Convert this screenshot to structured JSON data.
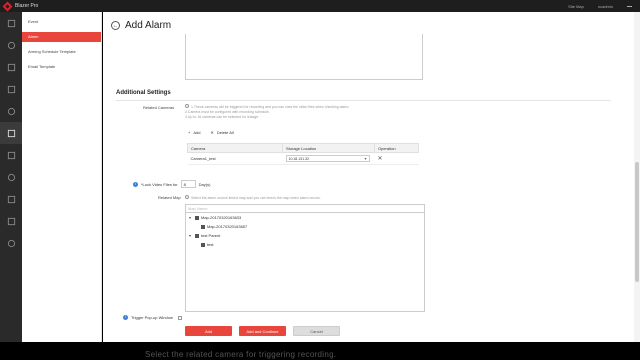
{
  "app": {
    "name": "Blazer Pro"
  },
  "topbar": {
    "site_map": "Site Map",
    "user": "ncadmin"
  },
  "rail_icons": [
    "home-icon",
    "cube-icon",
    "monitor-icon",
    "building-icon",
    "playback-icon",
    "alarm-icon",
    "grid-icon",
    "map-icon",
    "network-icon",
    "shield-icon",
    "gear-icon"
  ],
  "submenu": {
    "items": [
      {
        "label": "Event"
      },
      {
        "label": "Alarm"
      },
      {
        "label": "Arming Schedule Template"
      },
      {
        "label": "Email Template"
      }
    ],
    "active_index": 1
  },
  "page": {
    "title": "Add Alarm"
  },
  "section": {
    "title": "Additional Settings"
  },
  "related_cameras": {
    "label": "Related Cameras",
    "hint_lines": [
      "1.These cameras will be triggered for recording and you can view the video files when checking alarm.",
      "2.Camera must be configured with recording schedule.",
      "3.Up to 16 cameras can be selected for linkage."
    ],
    "add_label": "Add",
    "delete_all_label": "Delete All",
    "columns": [
      "Camera",
      "Storage Location",
      "Operation"
    ],
    "rows": [
      {
        "camera": "Camera1_test",
        "storage": "10.18.131.32"
      }
    ]
  },
  "lock_video": {
    "label": "*Lock Video Files for",
    "value": "8",
    "unit": "Day(s)"
  },
  "related_map": {
    "label": "Related Map",
    "hint": "Select the alarm source linked map and you can check the map when alarm occurs.",
    "search_placeholder": "Map Name",
    "tree": [
      {
        "label": "Map-20170320163633",
        "level": 0,
        "toggle": "▾"
      },
      {
        "label": "Map-20170320163657",
        "level": 1,
        "toggle": ""
      },
      {
        "label": "test Parent",
        "level": 0,
        "toggle": "▾"
      },
      {
        "label": "test",
        "level": 1,
        "toggle": ""
      }
    ]
  },
  "popup": {
    "label": "Trigger Pop-up Window"
  },
  "buttons": {
    "add": "Add",
    "add_continue": "Add and Continue",
    "cancel": "Cancel"
  },
  "caption": "Select the related camera for triggering recording.",
  "colors": {
    "accent": "#e8463c",
    "topbar": "#1e1e1e",
    "rail": "#2a2a2a"
  }
}
